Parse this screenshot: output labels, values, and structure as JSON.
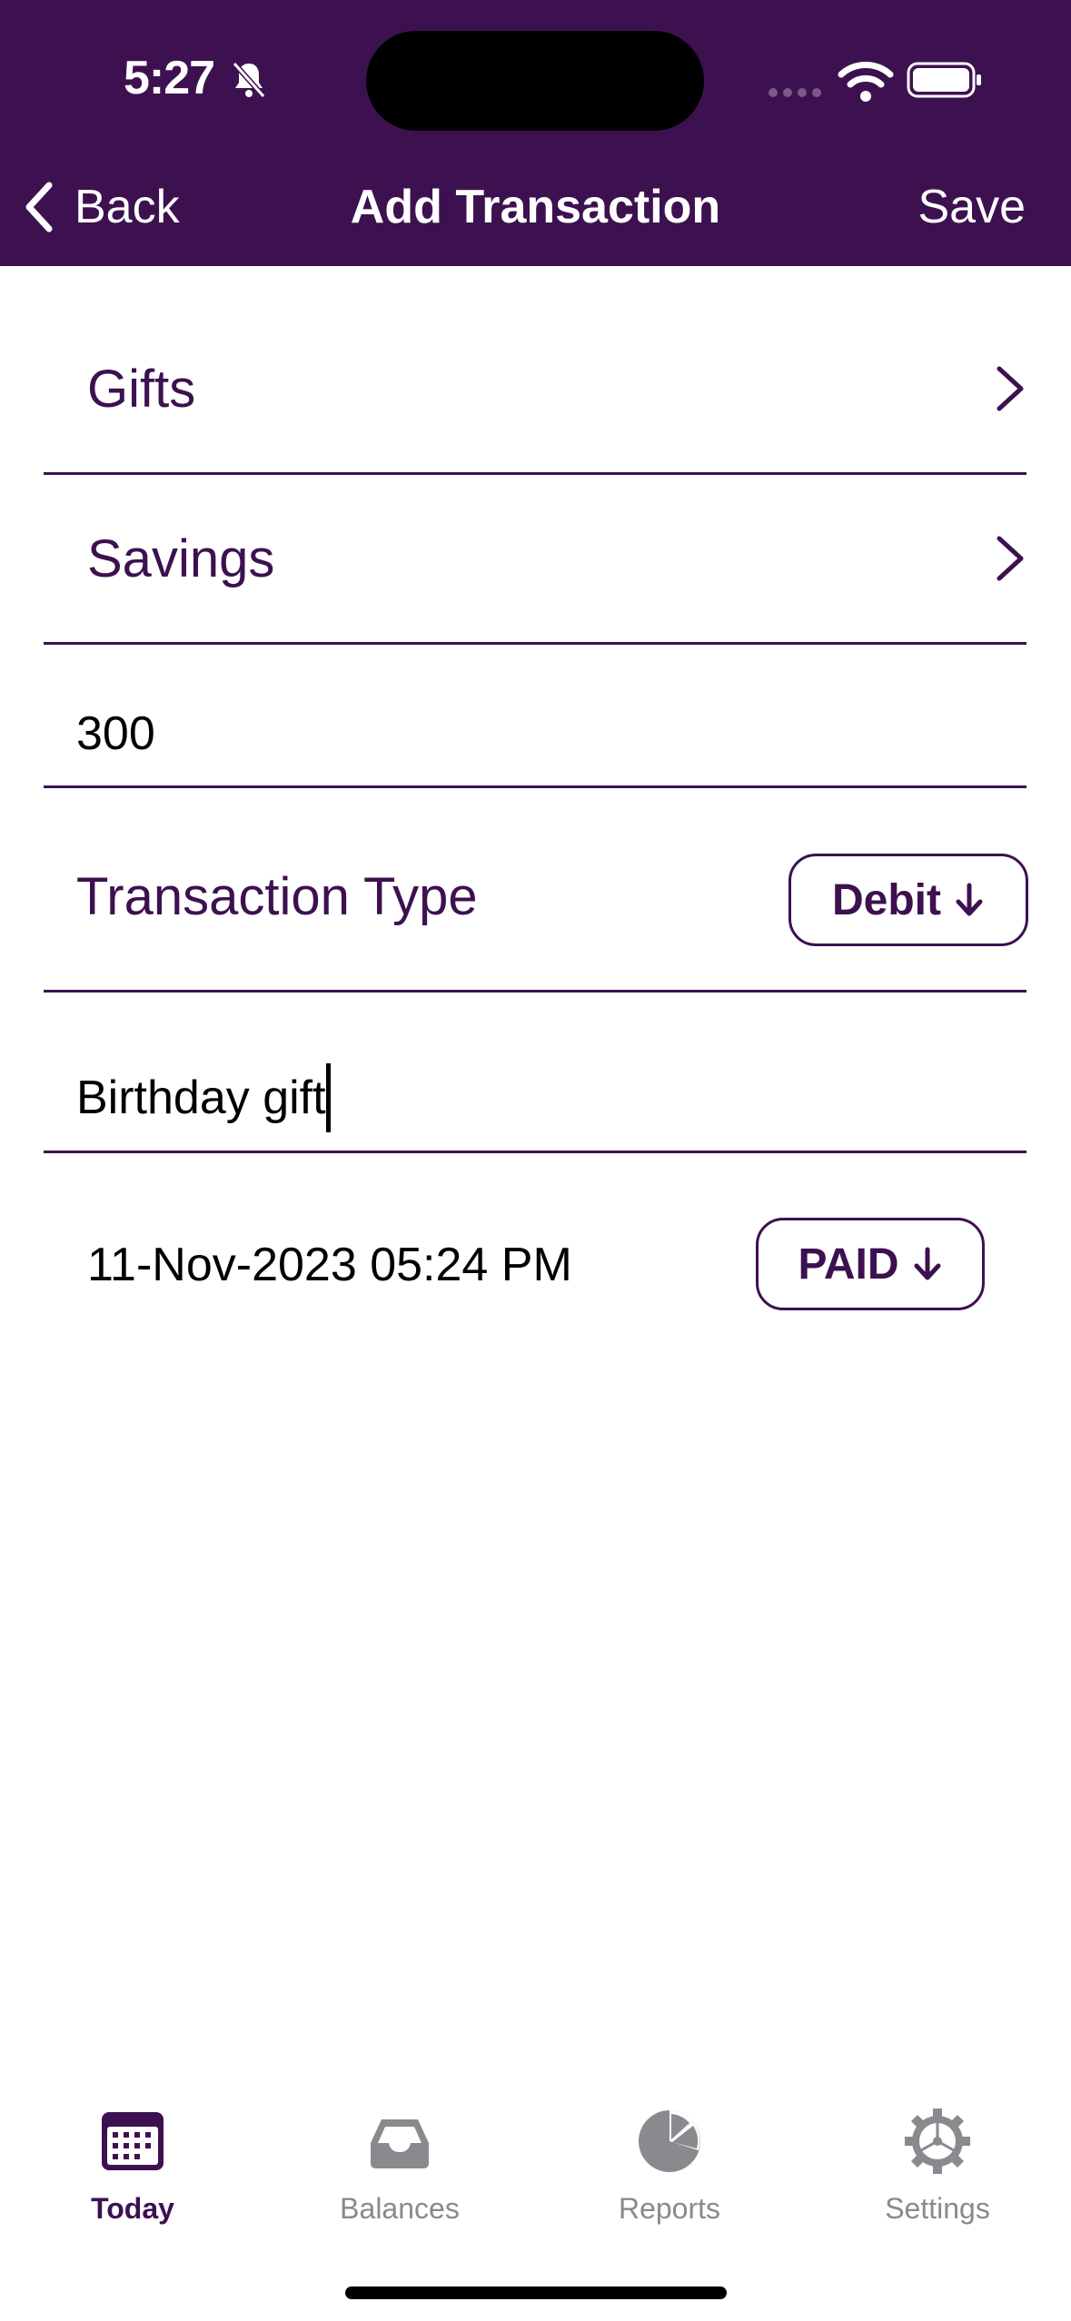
{
  "status_bar": {
    "time": "5:27"
  },
  "nav": {
    "back_label": "Back",
    "title": "Add Transaction",
    "save_label": "Save"
  },
  "form": {
    "category": "Gifts",
    "account": "Savings",
    "amount": "300",
    "transaction_type_label": "Transaction Type",
    "transaction_type_value": "Debit",
    "note": "Birthday gift",
    "date": "11-Nov-2023 05:24 PM",
    "status": "PAID"
  },
  "tabs": [
    {
      "label": "Today",
      "icon": "calendar-icon",
      "active": true
    },
    {
      "label": "Balances",
      "icon": "tray-icon",
      "active": false
    },
    {
      "label": "Reports",
      "icon": "pie-chart-icon",
      "active": false
    },
    {
      "label": "Settings",
      "icon": "gear-icon",
      "active": false
    }
  ],
  "colors": {
    "accent": "#3d1150",
    "inactive": "#8a8a8e"
  }
}
